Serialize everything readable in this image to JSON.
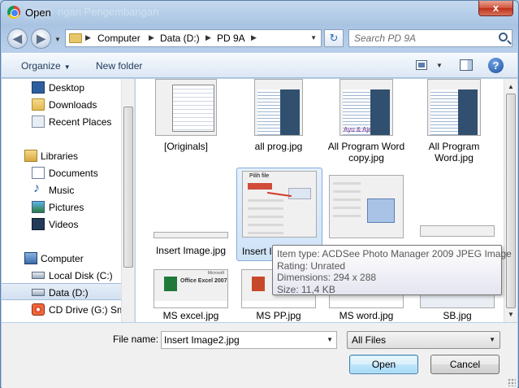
{
  "window": {
    "title": "Open",
    "background_title": "ngan Pengembangan",
    "close_label": "x"
  },
  "nav": {
    "back_glyph": "◀",
    "forward_glyph": "▶",
    "breadcrumbs": [
      "Computer",
      "Data (D:)",
      "PD 9A"
    ],
    "search_placeholder": "Search PD 9A",
    "refresh_glyph": "↻"
  },
  "toolbar": {
    "organize_label": "Organize",
    "new_folder_label": "New folder",
    "help_label": "?"
  },
  "sidebar": {
    "favorites": [
      {
        "label": "Desktop",
        "icon": "desktop-icon"
      },
      {
        "label": "Downloads",
        "icon": "folder-icon"
      },
      {
        "label": "Recent Places",
        "icon": "recent-places-icon"
      }
    ],
    "libraries_label": "Libraries",
    "libraries": [
      {
        "label": "Documents",
        "icon": "documents-icon"
      },
      {
        "label": "Music",
        "icon": "music-icon"
      },
      {
        "label": "Pictures",
        "icon": "pictures-icon"
      },
      {
        "label": "Videos",
        "icon": "videos-icon"
      }
    ],
    "computer_label": "Computer",
    "drives": [
      {
        "label": "Local Disk (C:)",
        "icon": "disk-icon"
      },
      {
        "label": "Data (D:)",
        "icon": "disk-icon",
        "selected": true
      },
      {
        "label": "CD Drive (G:) Sm",
        "icon": "cd-drive-icon"
      }
    ]
  },
  "files": {
    "row1": [
      "[Originals]",
      "all prog.jpg",
      "All Program Word copy.jpg",
      "All Program Word.jpg"
    ],
    "row1_sub": [
      "",
      "",
      "Ayu & Ajeng",
      ""
    ],
    "row2": [
      "Insert Image.jpg",
      "Insert I",
      "",
      ""
    ],
    "row3": [
      "MS excel.jpg",
      "MS PP.jpg",
      "MS word.jpg",
      "SB.jpg"
    ],
    "thumb_text": {
      "pilih_file": "Pilih file",
      "microsoft": "Microsoft",
      "office_excel": "Office Excel 2007"
    }
  },
  "tooltip": {
    "item_type": "Item type: ACDSee Photo Manager 2009 JPEG Image",
    "rating": "Rating: Unrated",
    "dimensions": "Dimensions: 294 x 288",
    "size": "Size: 11,4 KB"
  },
  "footer": {
    "file_name_label": "File name:",
    "file_name_value": "Insert Image2.jpg",
    "filter_value": "All Files",
    "open_label": "Open",
    "cancel_label": "Cancel"
  },
  "colors": {
    "accent": "#3c7fb1",
    "selection": "#cfe3f7",
    "close_red": "#c0311b"
  }
}
